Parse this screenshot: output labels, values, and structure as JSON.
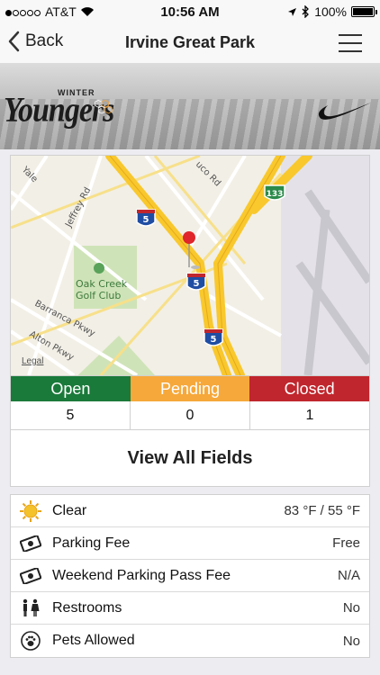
{
  "status_bar": {
    "carrier": "AT&T",
    "time": "10:56 AM",
    "battery": "100%"
  },
  "nav": {
    "back_label": "Back",
    "title": "Irvine Great Park"
  },
  "banner": {
    "event_top": "WINTER",
    "brand": "Youngers"
  },
  "map": {
    "labels": [
      "Yale",
      "Jeffrey Rd",
      "uco Rd",
      "Oak Creek",
      "Golf Club",
      "Barranca Pkwy",
      "Alton Pkwy"
    ],
    "shields": [
      "5",
      "5",
      "5",
      "133"
    ],
    "legal": "Legal"
  },
  "field_status": {
    "headers": [
      "Open",
      "Pending",
      "Closed"
    ],
    "counts": [
      "5",
      "0",
      "1"
    ],
    "colors": [
      "#1a7a3a",
      "#f6a83a",
      "#c0262d"
    ]
  },
  "view_all_label": "View All Fields",
  "info_rows": [
    {
      "icon": "sun-icon",
      "label": "Clear",
      "value": "83 °F / 55 °F"
    },
    {
      "icon": "cash-icon",
      "label": "Parking Fee",
      "value": "Free"
    },
    {
      "icon": "cash-icon",
      "label": "Weekend Parking Pass Fee",
      "value": "N/A"
    },
    {
      "icon": "restroom-icon",
      "label": "Restrooms",
      "value": "No"
    },
    {
      "icon": "paw-icon",
      "label": "Pets Allowed",
      "value": "No"
    }
  ]
}
